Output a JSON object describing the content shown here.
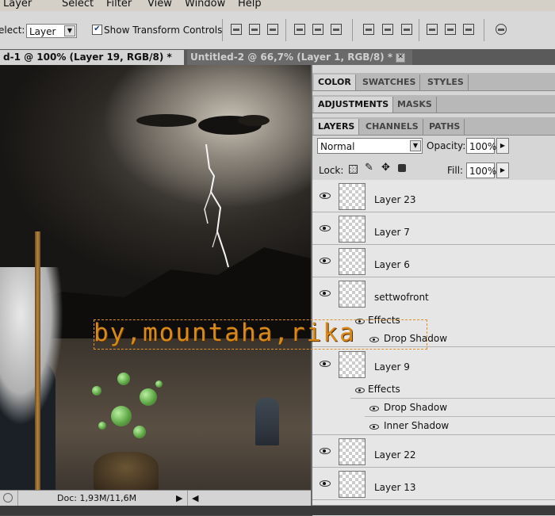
{
  "menu": [
    "Layer",
    "Select",
    "Filter",
    "View",
    "Window",
    "Help"
  ],
  "options": {
    "select_label": "elect:",
    "select_value": "Layer",
    "transform_checked": true,
    "transform_label": "Show Transform Controls"
  },
  "doc_tabs": [
    {
      "label": "d-1 @ 100% (Layer 19, RGB/8) *",
      "close": "✕"
    },
    {
      "label": "Untitled-2 @ 66,7% (Layer 1, RGB/8) *",
      "close": "✕"
    }
  ],
  "canvas": {
    "watermark": "by,mountaha,rika"
  },
  "status": {
    "doc": "Doc: 1,93M/11,6M"
  },
  "panels": {
    "row1": [
      "COLOR",
      "SWATCHES",
      "STYLES"
    ],
    "row2": [
      "ADJUSTMENTS",
      "MASKS"
    ],
    "row3": [
      "LAYERS",
      "CHANNELS",
      "PATHS"
    ]
  },
  "layers_panel": {
    "blend_mode": "Normal",
    "opacity_label": "Opacity:",
    "opacity_value": "100%",
    "lock_label": "Lock:",
    "fill_label": "Fill:",
    "fill_value": "100%"
  },
  "layers": [
    {
      "name": "Layer 23"
    },
    {
      "name": "Layer 7"
    },
    {
      "name": "Layer 6"
    },
    {
      "name": "settwofront"
    },
    {
      "name": "Layer 9"
    },
    {
      "name": "Layer 22"
    },
    {
      "name": "Layer 13"
    }
  ],
  "effects": {
    "settwofront": {
      "effects": "Effects",
      "items": [
        "Drop Shadow"
      ]
    },
    "layer9": {
      "effects": "Effects",
      "items": [
        "Drop Shadow",
        "Inner Shadow"
      ]
    }
  }
}
